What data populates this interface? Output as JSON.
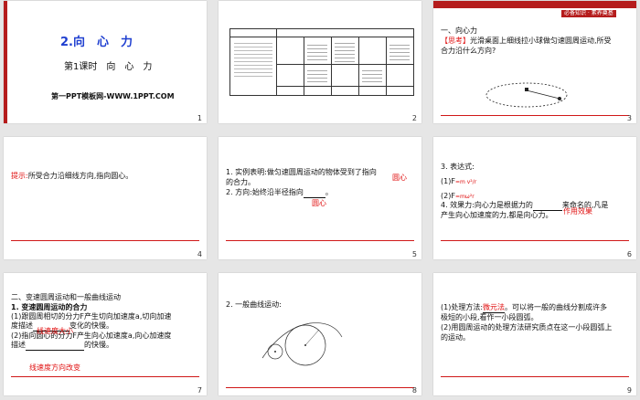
{
  "slides": [
    {
      "num": "1",
      "title": "2.向　心　力",
      "subtitle": "第1课时　向　心　力",
      "footer": "第一PPT模板网-WWW.1PPT.COM"
    },
    {
      "num": "2"
    },
    {
      "num": "3",
      "badge": "必备知识 · 素养奠基",
      "heading": "一、向心力",
      "label": "【思考】",
      "question_l1": "光滑桌面上细线拉小球做匀速圆周运动,所受",
      "question_l2": "合力沿什么方向?"
    },
    {
      "num": "4",
      "hint_label": "提示:",
      "hint_text": "所受合力沿细线方向,指向圆心。"
    },
    {
      "num": "5",
      "line1": "1. 实例表明:做匀速圆周运动的物体受到了指向",
      "line1_answer": "圆心",
      "line2": "的合力。",
      "line3": "2. 方向:始终沿半径指向",
      "line3_answer": "圆心"
    },
    {
      "num": "6",
      "line1": "3. 表达式:",
      "f1": "(1)F",
      "f1_rhs": "=m v²/r",
      "f2": "(2)F",
      "f2_rhs": "=mω²r",
      "line4": "4. 效果力:向心力是根据力的",
      "line4_tail": "来命名的,凡是",
      "line5": "产生向心加速度的力,都是向心力。",
      "answer": "作用效果"
    },
    {
      "num": "7",
      "heading": "二、变速圆周运动和一般曲线运动",
      "sub": "1. 变速圆周运动的合力",
      "l1": "(1)跟圆周相切的分力F",
      "l1b": "产生切向加速度a",
      "l1c": ",切向加速",
      "l2a": "度描述",
      "l2b": "变化的快慢。",
      "l3a": "(2)指向圆心的分力F",
      "l3b": "产生向心加速度a",
      "l3c": ",向心加速度",
      "l4a": "描述",
      "l4b": "的快慢。",
      "ans1": "线速度大小",
      "ans2": "线速度方向改变"
    },
    {
      "num": "8",
      "heading": "2. 一般曲线运动:"
    },
    {
      "num": "9",
      "l1a": "(1)处理方法:",
      "l1ans": "微元法",
      "l1b": "。可以将一般的曲线分割成许多",
      "l2": "极短的小段,看作一小段圆弧。",
      "l3": "(2)用圆周运动的处理方法研究质点在这一小段圆弧上",
      "l4": "的运动。"
    }
  ],
  "colors": {
    "accent": "#b51c1c",
    "red": "#e01010",
    "blue": "#1f3fd0"
  }
}
